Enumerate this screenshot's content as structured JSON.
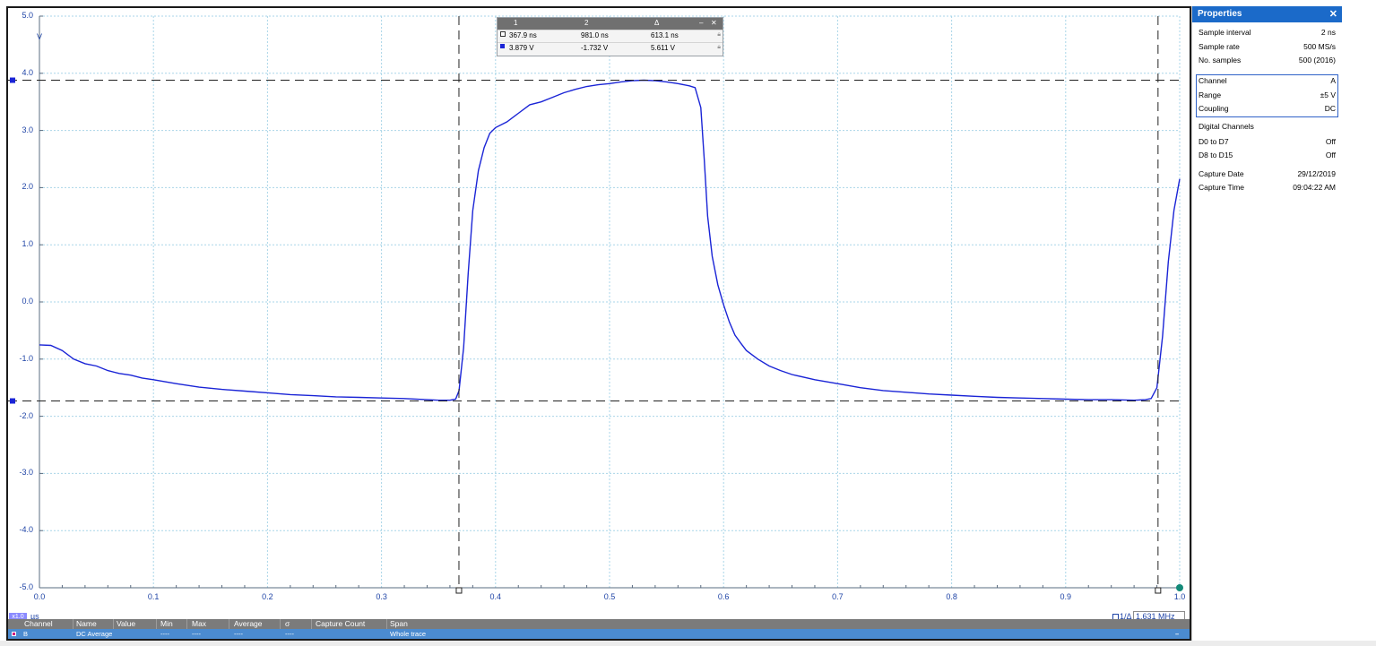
{
  "chart_data": {
    "type": "line",
    "xlabel": "",
    "ylabel": "",
    "x_unit": "µs",
    "y_unit": "V",
    "xlim": [
      0.0,
      1.0
    ],
    "ylim": [
      -5.0,
      5.0
    ],
    "x_ticks": [
      "0.0",
      "0.1",
      "0.2",
      "0.3",
      "0.4",
      "0.5",
      "0.6",
      "0.7",
      "0.8",
      "0.9",
      "1.0"
    ],
    "y_ticks": [
      "5.0",
      "4.0",
      "3.0",
      "2.0",
      "1.0",
      "0.0",
      "-1.0",
      "-2.0",
      "-3.0",
      "-4.0",
      "-5.0"
    ],
    "grid": true,
    "series": [
      {
        "color": "#1a24d6",
        "x": [
          0.0,
          0.01,
          0.02,
          0.03,
          0.04,
          0.05,
          0.06,
          0.07,
          0.08,
          0.09,
          0.1,
          0.12,
          0.14,
          0.16,
          0.18,
          0.2,
          0.22,
          0.24,
          0.26,
          0.28,
          0.3,
          0.32,
          0.34,
          0.35,
          0.36,
          0.365,
          0.368,
          0.372,
          0.376,
          0.38,
          0.385,
          0.39,
          0.395,
          0.4,
          0.41,
          0.42,
          0.43,
          0.44,
          0.45,
          0.46,
          0.47,
          0.48,
          0.49,
          0.5,
          0.51,
          0.52,
          0.53,
          0.54,
          0.55,
          0.56,
          0.57,
          0.575,
          0.58,
          0.583,
          0.586,
          0.59,
          0.595,
          0.6,
          0.605,
          0.61,
          0.615,
          0.62,
          0.63,
          0.64,
          0.65,
          0.66,
          0.68,
          0.7,
          0.72,
          0.74,
          0.76,
          0.78,
          0.8,
          0.82,
          0.84,
          0.86,
          0.88,
          0.9,
          0.92,
          0.94,
          0.96,
          0.97,
          0.975,
          0.98,
          0.985,
          0.99,
          0.995,
          1.0
        ],
        "y": [
          -0.75,
          -0.76,
          -0.85,
          -1.0,
          -1.08,
          -1.12,
          -1.2,
          -1.25,
          -1.28,
          -1.33,
          -1.36,
          -1.43,
          -1.49,
          -1.53,
          -1.56,
          -1.59,
          -1.62,
          -1.64,
          -1.66,
          -1.67,
          -1.68,
          -1.69,
          -1.71,
          -1.72,
          -1.72,
          -1.7,
          -1.55,
          -0.8,
          0.5,
          1.6,
          2.3,
          2.7,
          2.95,
          3.05,
          3.15,
          3.3,
          3.45,
          3.5,
          3.58,
          3.66,
          3.72,
          3.77,
          3.8,
          3.82,
          3.85,
          3.87,
          3.88,
          3.87,
          3.85,
          3.82,
          3.78,
          3.75,
          3.4,
          2.5,
          1.5,
          0.8,
          0.3,
          -0.05,
          -0.35,
          -0.58,
          -0.72,
          -0.85,
          -1.0,
          -1.12,
          -1.2,
          -1.27,
          -1.36,
          -1.43,
          -1.5,
          -1.55,
          -1.58,
          -1.61,
          -1.63,
          -1.65,
          -1.67,
          -1.68,
          -1.69,
          -1.7,
          -1.71,
          -1.71,
          -1.72,
          -1.71,
          -1.69,
          -1.5,
          -0.6,
          0.7,
          1.6,
          2.15
        ]
      }
    ],
    "cursors": {
      "x": [
        0.3679,
        0.981
      ],
      "y": [
        3.879,
        -1.732
      ]
    }
  },
  "ruler": {
    "headers": [
      "1",
      "2",
      "Δ"
    ],
    "row1": [
      "367.9 ns",
      "981.0 ns",
      "613.1 ns"
    ],
    "row2": [
      "3.879 V",
      "-1.732 V",
      "5.611 V"
    ],
    "minimize": "–",
    "close": "✕",
    "row1_color": "#ffffff",
    "row2_color": "#1a24d6"
  },
  "timebase": {
    "zoom": "x1.0",
    "unit": "µs",
    "freq_label": "1/Δ",
    "freq_value": "1.631 MHz"
  },
  "properties": {
    "title": "Properties",
    "close": "✕",
    "rows": [
      {
        "k": "Sample interval",
        "v": "2 ns"
      },
      {
        "k": "Sample rate",
        "v": "500 MS/s"
      },
      {
        "k": "No. samples",
        "v": "500  (2016)"
      },
      {
        "k": "Channel",
        "v": "A"
      },
      {
        "k": "Range",
        "v": "±5 V"
      },
      {
        "k": "Coupling",
        "v": "DC"
      },
      {
        "k": "Digital Channels",
        "v": ""
      },
      {
        "k": "D0 to D7",
        "v": "Off"
      },
      {
        "k": "D8 to D15",
        "v": "Off"
      },
      {
        "k": "Capture Date",
        "v": "29/12/2019"
      },
      {
        "k": "Capture Time",
        "v": "09:04:22 AM"
      }
    ]
  },
  "measurements": {
    "headers": [
      "Channel",
      "Name",
      "Value",
      "Min",
      "Max",
      "Average",
      "σ",
      "Capture Count",
      "Span"
    ],
    "row": [
      "B",
      "DC Average",
      "",
      "----",
      "----",
      "----",
      "----",
      "",
      "Whole trace"
    ],
    "collapse": "–"
  }
}
